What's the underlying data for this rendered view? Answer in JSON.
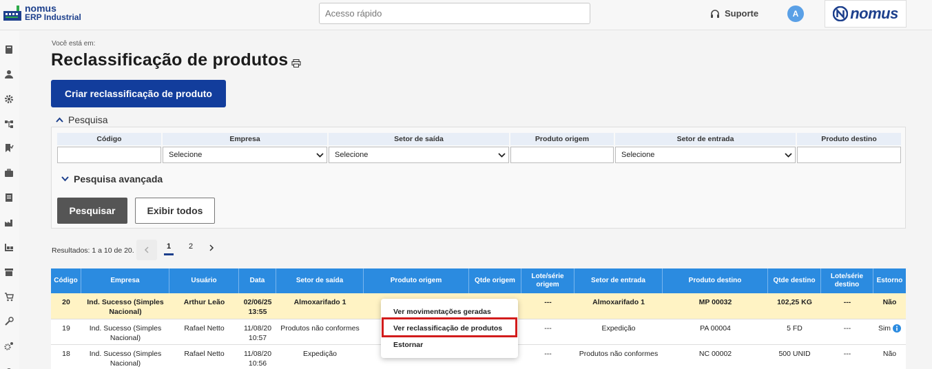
{
  "header": {
    "logo_line1": "nomus",
    "logo_line2": "ERP Industrial",
    "quick_access_placeholder": "Acesso rápido",
    "support_label": "Suporte",
    "avatar_initial": "A",
    "brand_name": "nomus"
  },
  "sidebar": {
    "icons": [
      "book-icon",
      "user-icon",
      "gear-icon",
      "hierarchy-icon",
      "bookmark-check-icon",
      "briefcase-icon",
      "document-icon",
      "factory-icon",
      "warehouse-icon",
      "box-icon",
      "cart-icon",
      "tools-icon",
      "settings-cogs-icon"
    ]
  },
  "page": {
    "breadcrumb": "Você está em:",
    "title": "Reclassificação de produtos",
    "create_button": "Criar reclassificação de produto"
  },
  "search": {
    "section_label": "Pesquisa",
    "advanced_label": "Pesquisa avançada",
    "fields": {
      "codigo": "Código",
      "empresa": "Empresa",
      "setor_saida": "Setor de saída",
      "produto_origem": "Produto origem",
      "setor_entrada": "Setor de entrada",
      "produto_destino": "Produto destino"
    },
    "select_default": "Selecione",
    "search_button": "Pesquisar",
    "show_all_button": "Exibir todos"
  },
  "pagination": {
    "results_text": "Resultados: 1 a 10 de 20.",
    "pages": [
      "1",
      "2"
    ],
    "current": "1"
  },
  "table": {
    "columns": [
      "Código",
      "Empresa",
      "Usuário",
      "Data",
      "Setor de saída",
      "Produto origem",
      "Qtde origem",
      "Lote/série origem",
      "Setor de entrada",
      "Produto destino",
      "Qtde destino",
      "Lote/série destino",
      "Estorno"
    ],
    "rows": [
      {
        "codigo": "20",
        "empresa": "Ind. Sucesso (Simples Nacional)",
        "usuario": "Arthur Leão",
        "data": "02/06/25 13:55",
        "setor_saida": "Almoxarifado 1",
        "produto_origem": "",
        "qtde_origem": "",
        "lote_origem": "---",
        "setor_entrada": "Almoxarifado 1",
        "produto_destino": "MP 00032",
        "qtde_destino": "102,25 KG",
        "lote_destino": "---",
        "estorno": "Não"
      },
      {
        "codigo": "19",
        "empresa": "Ind. Sucesso (Simples Nacional)",
        "usuario": "Rafael Netto",
        "data": "11/08/20 10:57",
        "setor_saida": "Produtos não conformes",
        "produto_origem": "",
        "qtde_origem": "",
        "lote_origem": "---",
        "setor_entrada": "Expedição",
        "produto_destino": "PA 00004",
        "qtde_destino": "5 FD",
        "lote_destino": "---",
        "estorno": "Sim"
      },
      {
        "codigo": "18",
        "empresa": "Ind. Sucesso (Simples Nacional)",
        "usuario": "Rafael Netto",
        "data": "11/08/20 10:56",
        "setor_saida": "Expedição",
        "produto_origem": "",
        "qtde_origem": "",
        "lote_origem": "---",
        "setor_entrada": "Produtos não conformes",
        "produto_destino": "NC 00002",
        "qtde_destino": "500 UNID",
        "lote_destino": "---",
        "estorno": "Não"
      }
    ]
  },
  "context_menu": {
    "items": [
      "Ver movimentações geradas",
      "Ver reclassificação de produtos",
      "Estornar"
    ],
    "highlighted": "Ver reclassificação de produtos"
  },
  "colors": {
    "primary": "#123d9c",
    "table_header": "#2b8be0",
    "selected_row": "#fff3c4",
    "highlight_border": "#d21c1c"
  }
}
